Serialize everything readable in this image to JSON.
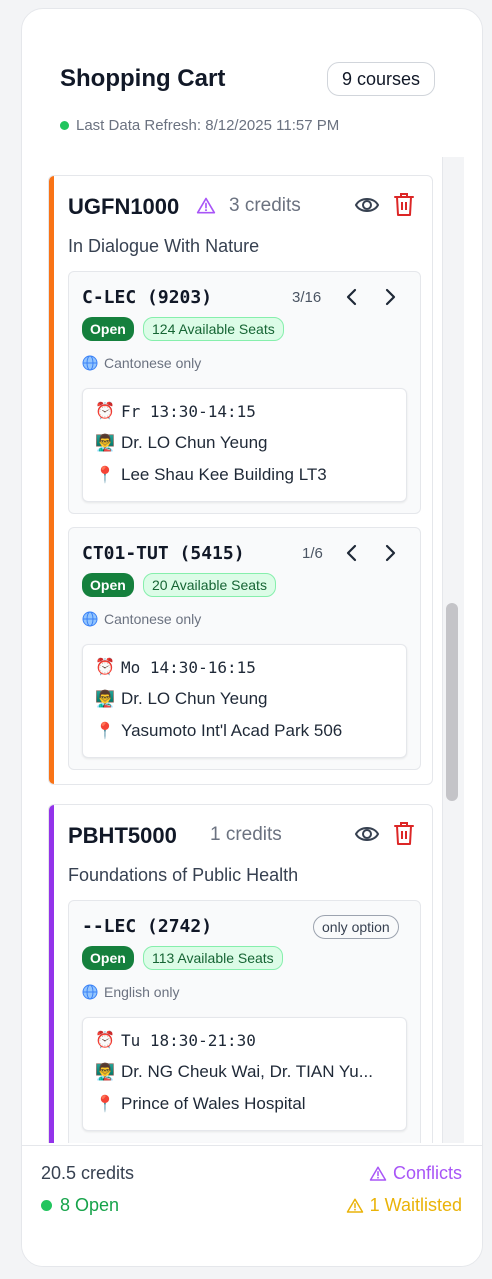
{
  "header": {
    "title": "Shopping Cart",
    "course_count": "9 courses",
    "refresh_text": "Last Data Refresh: 8/12/2025 11:57 PM"
  },
  "courses": [
    {
      "code": "UGFN1000",
      "credits": "3 credits",
      "name": "In Dialogue With Nature",
      "accent": "#f97316",
      "has_warning": true,
      "sections": [
        {
          "title": "C-LEC (9203)",
          "pager": "3/16",
          "status": "Open",
          "seats": "124 Available Seats",
          "language": "Cantonese only",
          "meeting": {
            "time": "Fr 13:30-14:15",
            "instructor": "Dr. LO Chun Yeung",
            "location": "Lee Shau Kee Building LT3"
          }
        },
        {
          "title": "CT01-TUT (5415)",
          "pager": "1/6",
          "status": "Open",
          "seats": "20 Available Seats",
          "language": "Cantonese only",
          "meeting": {
            "time": "Mo 14:30-16:15",
            "instructor": "Dr. LO Chun Yeung",
            "location": "Yasumoto Int'l Acad Park 506"
          }
        }
      ]
    },
    {
      "code": "PBHT5000",
      "credits": "1 credits",
      "name": "Foundations of Public Health",
      "accent": "#9333ea",
      "has_warning": false,
      "sections": [
        {
          "title": "--LEC (2742)",
          "badge": "only option",
          "status": "Open",
          "seats": "113 Available Seats",
          "language": "English only",
          "meeting": {
            "time": "Tu 18:30-21:30",
            "instructor": "Dr. NG Cheuk Wai, Dr. TIAN Yu...",
            "location": "Prince of Wales Hospital"
          }
        }
      ]
    }
  ],
  "footer": {
    "total_credits": "20.5 credits",
    "open_count": "8 Open",
    "conflicts": "Conflicts",
    "waitlisted": "1 Waitlisted"
  },
  "icons": {
    "clock": "alarm-clock-icon",
    "instructor": "teacher-icon",
    "location": "pin-icon",
    "language": "globe-icon"
  }
}
